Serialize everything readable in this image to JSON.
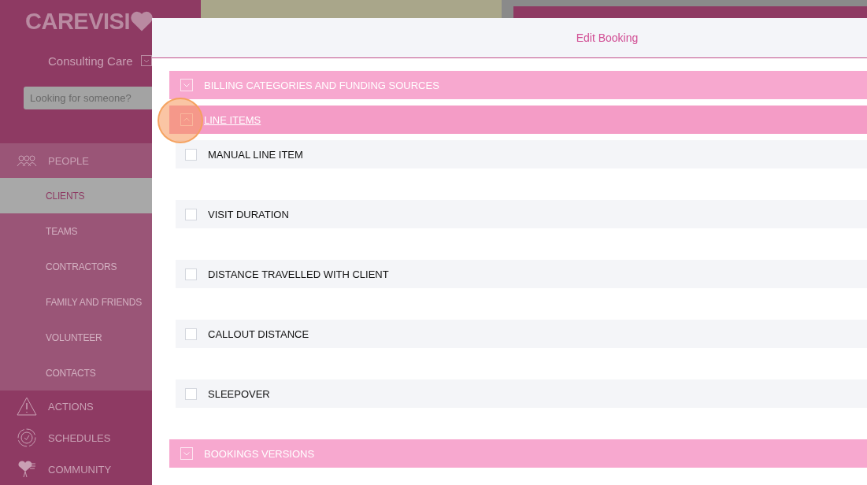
{
  "sidebar": {
    "logo": "CAREVISI",
    "account": "Consulting Care",
    "search": {
      "placeholder": "Looking for someone?"
    },
    "items": [
      {
        "kind": "people",
        "label": "PEOPLE",
        "selected": false,
        "expanded": true,
        "children": [
          {
            "label": "CLIENTS",
            "selected": true
          },
          {
            "label": "TEAMS",
            "selected": false
          },
          {
            "label": "CONTRACTORS",
            "selected": false
          },
          {
            "label": "FAMILY AND FRIENDS",
            "selected": false
          },
          {
            "label": "VOLUNTEER",
            "selected": false
          },
          {
            "label": "CONTACTS",
            "selected": false
          }
        ]
      },
      {
        "kind": "actions",
        "label": "ACTIONS",
        "selected": false
      },
      {
        "kind": "schedules",
        "label": "SCHEDULES",
        "selected": false
      },
      {
        "kind": "community",
        "label": "COMMUNITY",
        "selected": false
      }
    ]
  },
  "modal": {
    "title": "Edit Booking",
    "sections": [
      {
        "title": "BILLING CATEGORIES AND FUNDING SOURCES",
        "expanded": false
      },
      {
        "title": "LINE ITEMS",
        "expanded": true,
        "items": [
          {
            "label": "MANUAL LINE ITEM",
            "checked": false
          },
          {
            "label": "VISIT DURATION",
            "checked": false
          },
          {
            "label": "DISTANCE TRAVELLED WITH CLIENT",
            "checked": false
          },
          {
            "label": "CALLOUT DISTANCE",
            "checked": false
          },
          {
            "label": "SLEEPOVER",
            "checked": false
          }
        ]
      },
      {
        "title": "BOOKINGS VERSIONS",
        "expanded": false
      }
    ]
  }
}
